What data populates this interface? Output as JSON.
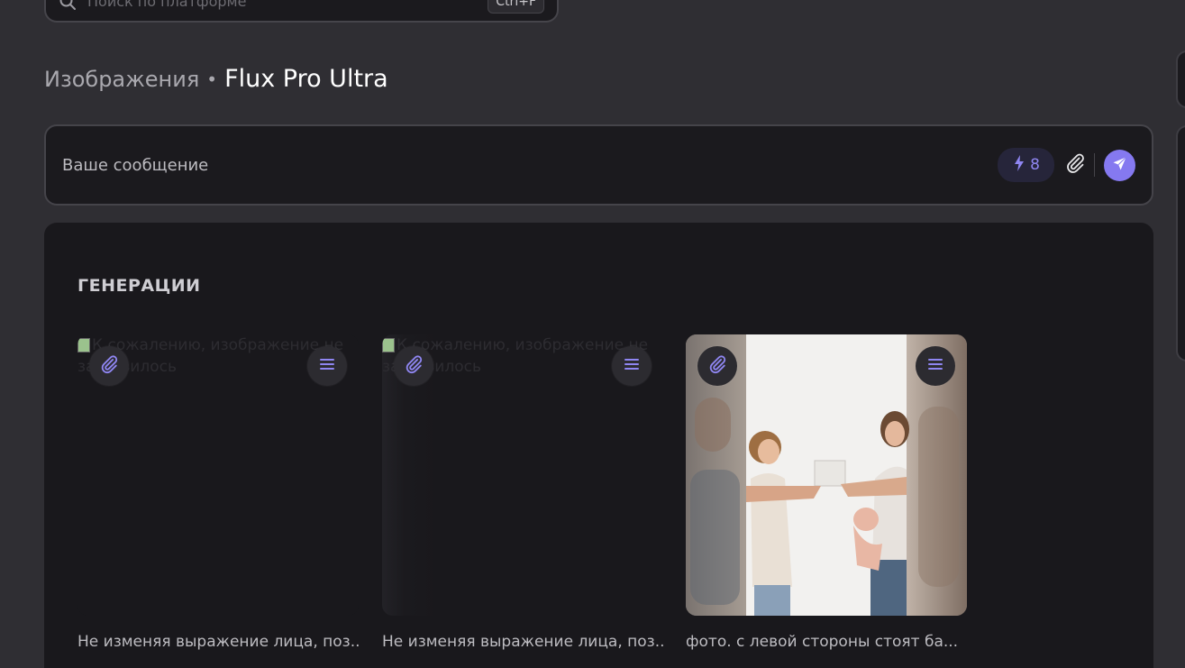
{
  "search": {
    "placeholder": "Поиск по платформе",
    "shortcut": "Ctrl+F",
    "icon": "search-icon"
  },
  "breadcrumb": {
    "section": "Изображения",
    "separator": "•",
    "current": "Flux Pro Ultra"
  },
  "composer": {
    "placeholder": "Ваше сообщение",
    "credits": "8",
    "credits_icon": "lightning-icon",
    "attach_icon": "paperclip-icon",
    "send_icon": "send-icon",
    "accent": "#8579f0"
  },
  "generations": {
    "title": "ГЕНЕРАЦИИ",
    "items": [
      {
        "alt_text": "К сожалению, изображение не загрузилось",
        "caption": "Не изменяя выражение лица, поз...",
        "status": "broken"
      },
      {
        "alt_text": "К сожалению, изображение не загрузилось",
        "caption": "Не изменяя выражение лица, поз...",
        "status": "broken"
      },
      {
        "alt_text": "",
        "caption": "фото. с левой стороны стоят ба...",
        "status": "loaded"
      }
    ]
  }
}
